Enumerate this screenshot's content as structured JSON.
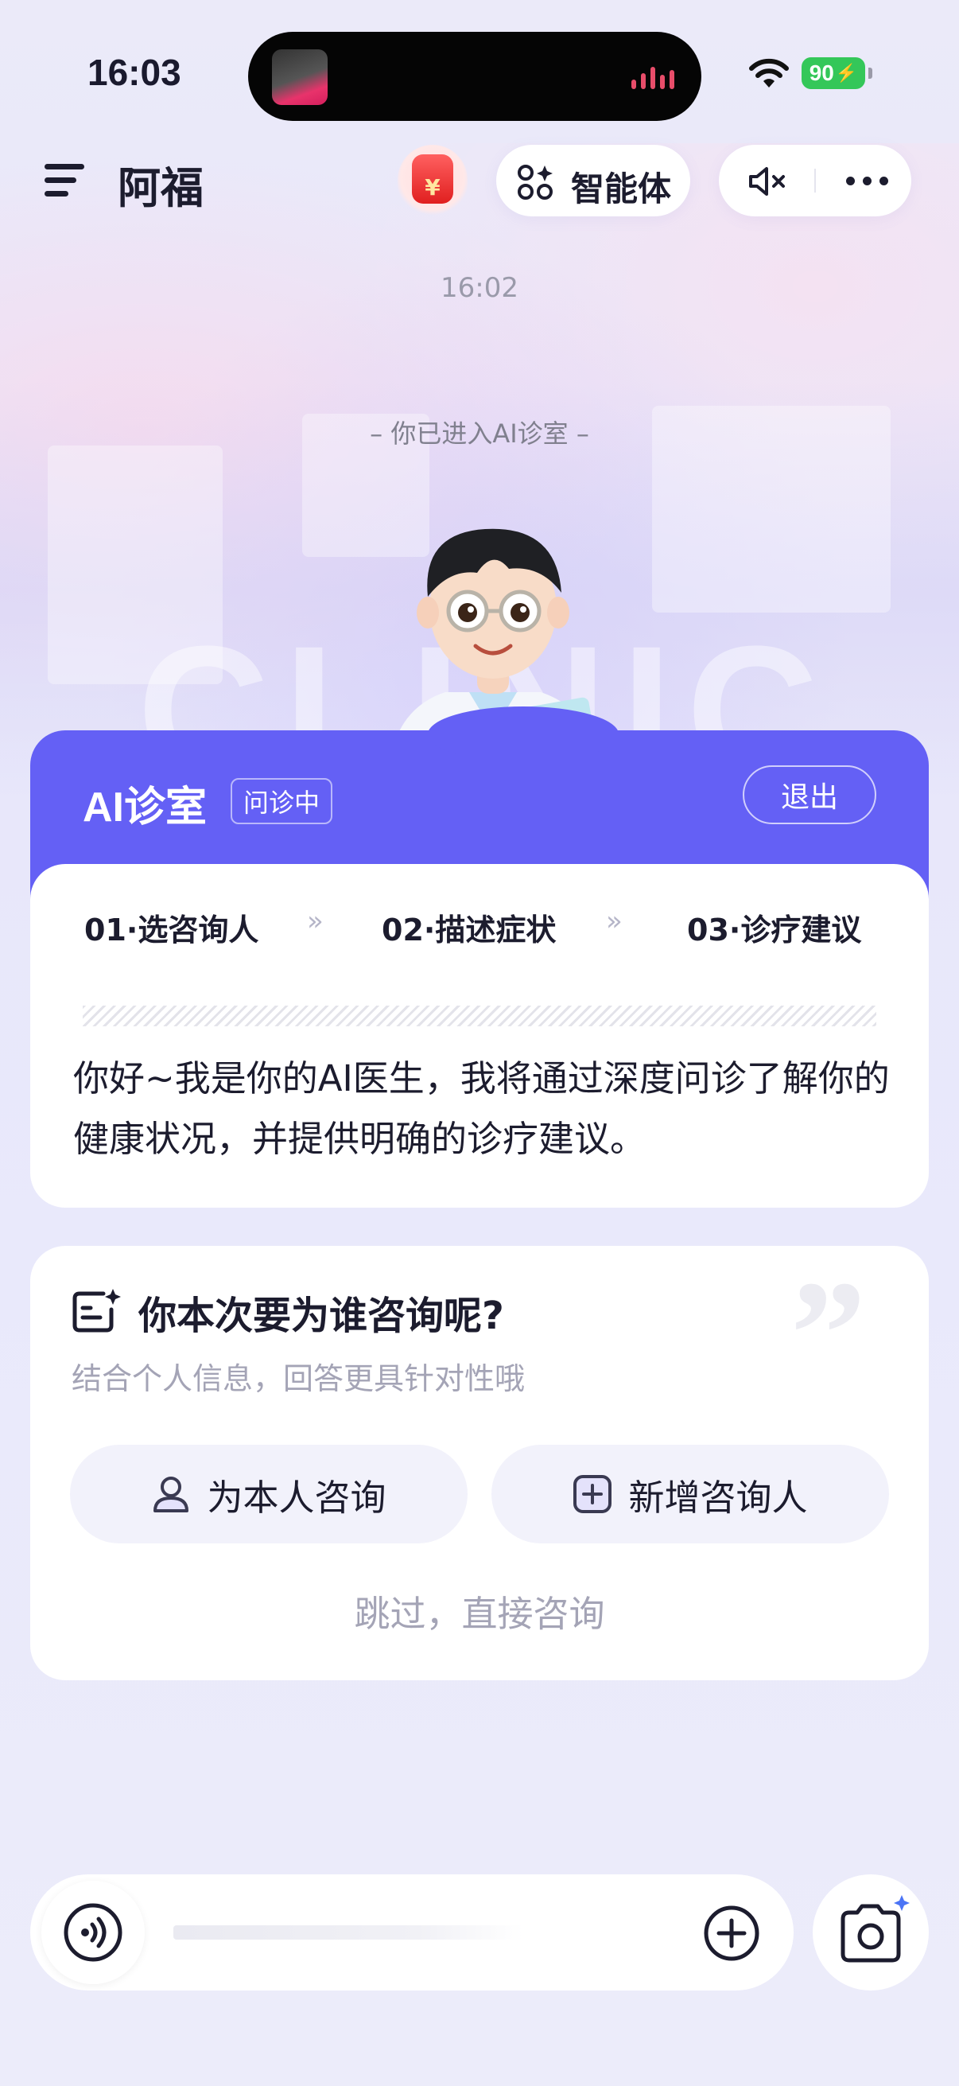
{
  "status_bar": {
    "time": "16:03",
    "battery": "90"
  },
  "header": {
    "app_title": "阿福",
    "agent_label": "智能体",
    "icons": [
      "menu-icon",
      "red-packet-icon",
      "agent-grid-icon",
      "mute-icon",
      "more-icon"
    ]
  },
  "chat": {
    "timestamp": "16:02",
    "enter_note": "–   你已进入AI诊室   –",
    "watermark": "CLINIC"
  },
  "clinic": {
    "title": "AI诊室",
    "status": "问诊中",
    "exit_label": "退出",
    "steps": [
      {
        "label": "01·选咨询人"
      },
      {
        "label": "02·描述症状"
      },
      {
        "label": "03·诊疗建议"
      }
    ],
    "step_separator": "»",
    "intro": "你好~我是你的AI医生，我将通过深度问诊了解你的健康状况，并提供明确的诊疗建议。"
  },
  "consult": {
    "question": "你本次要为谁咨询呢?",
    "subtitle": "结合个人信息，回答更具针对性哦",
    "self_label": "为本人咨询",
    "add_label": "新增咨询人",
    "skip_label": "跳过，直接咨询"
  },
  "colors": {
    "accent": "#6460f5",
    "background": "#e9e9fb",
    "muted_text": "#a4a4b6"
  }
}
